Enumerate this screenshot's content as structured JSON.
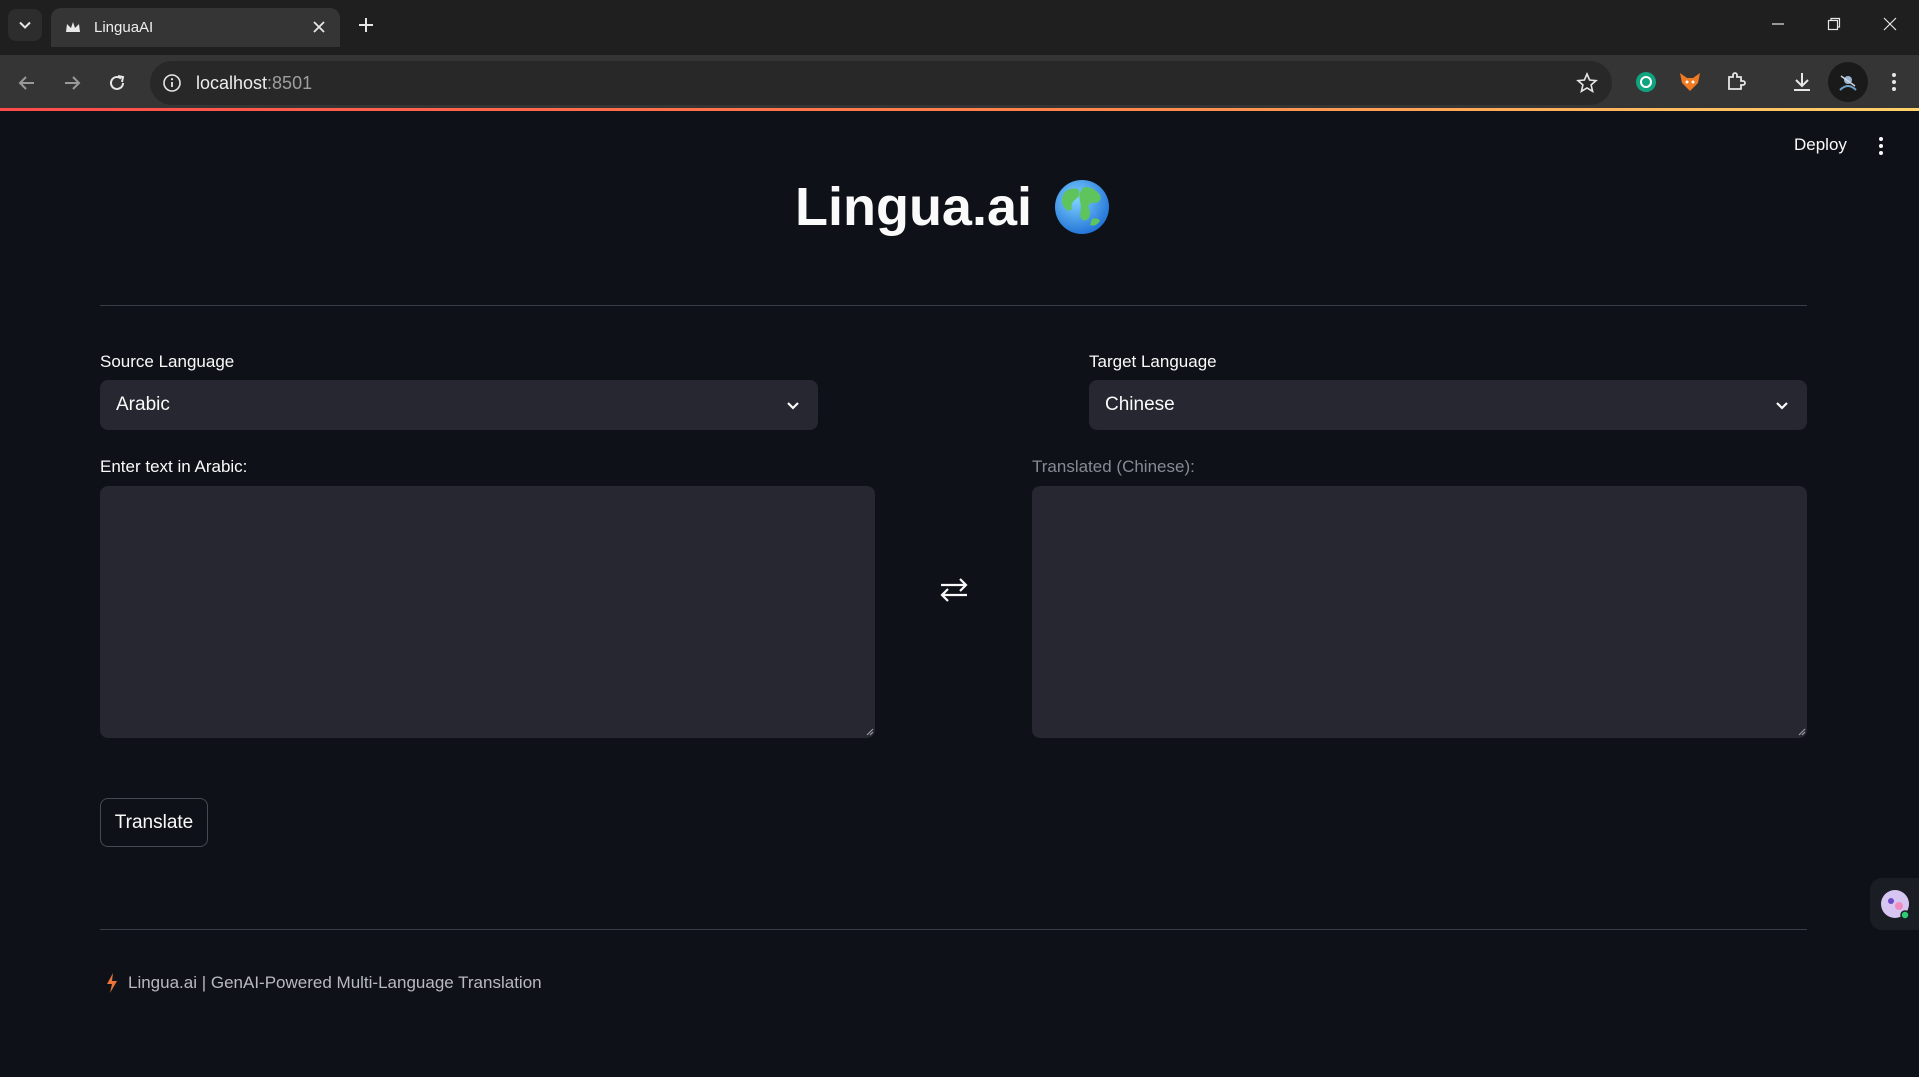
{
  "browser": {
    "tab_title": "LinguaAI",
    "url_host": "localhost",
    "url_port": ":8501"
  },
  "app": {
    "deploy_label": "Deploy",
    "title": "Lingua.ai",
    "title_emoji": "globe",
    "source_label": "Source Language",
    "source_value": "Arabic",
    "target_label": "Target Language",
    "target_value": "Chinese",
    "input_label": "Enter text in Arabic:",
    "input_value": "",
    "output_label": "Translated (Chinese):",
    "output_value": "",
    "translate_button": "Translate",
    "footer_text": "Lingua.ai | GenAI-Powered Multi-Language Translation"
  },
  "colors": {
    "background": "#0e1117",
    "input_bg": "#262730",
    "accent": "#ff4b4b"
  }
}
